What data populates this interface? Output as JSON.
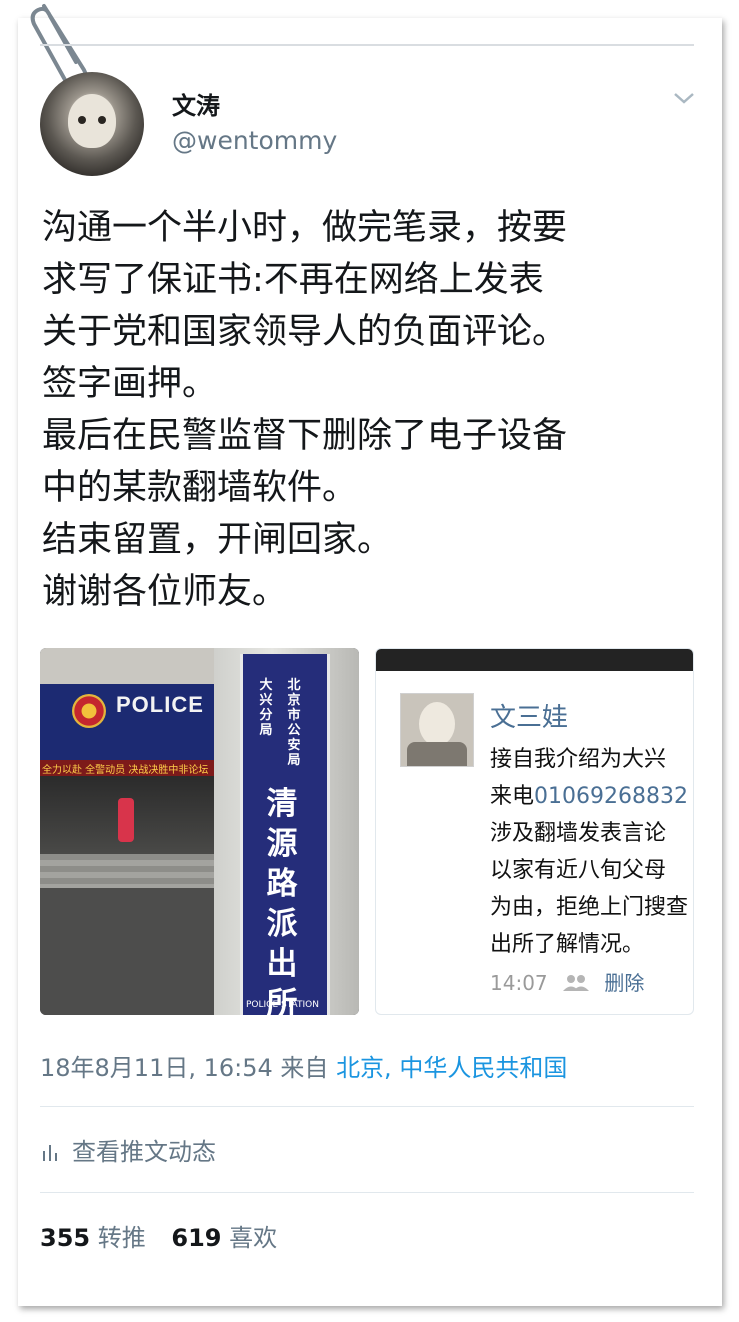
{
  "user": {
    "name": "文涛",
    "handle": "@wentommy"
  },
  "tweet": {
    "lines": [
      "沟通一个半小时，做完笔录，按要",
      "求写了保证书:不再在网络上发表",
      "关于党和国家领导人的负面评论。",
      "签字画押。",
      "最后在民警监督下删除了电子设备",
      "中的某款翻墙软件。",
      "结束留置，开闸回家。",
      "谢谢各位师友。"
    ]
  },
  "photo1": {
    "banner": "POLICE",
    "red_text": "全力以赴 全警动员 决战决胜中非论坛",
    "sign_small_right": "北京市公安局",
    "sign_small_left": "大兴分局",
    "sign_big": "清源路派出所",
    "sign_bottom": "POLICE STATION"
  },
  "photo2": {
    "name": "文三娃",
    "lines": [
      "接自我介绍为大兴",
      "涉及翻墙发表言论",
      "以家有近八旬父母",
      "为由，拒绝上门搜查",
      "出所了解情况。"
    ],
    "phone_prefix": "来电",
    "phone": "01069268832",
    "time": "14:07",
    "delete_label": "删除"
  },
  "meta": {
    "datetime": "18年8月11日, 16:54",
    "from_label": "来自",
    "location": "北京, 中华人民共和国"
  },
  "activity": {
    "label": "查看推文动态"
  },
  "stats": {
    "retweets": "355",
    "retweets_label": "转推",
    "likes": "619",
    "likes_label": "喜欢"
  },
  "colors": {
    "link": "#1b95e0",
    "secondary": "#657786",
    "text": "#14171a"
  }
}
